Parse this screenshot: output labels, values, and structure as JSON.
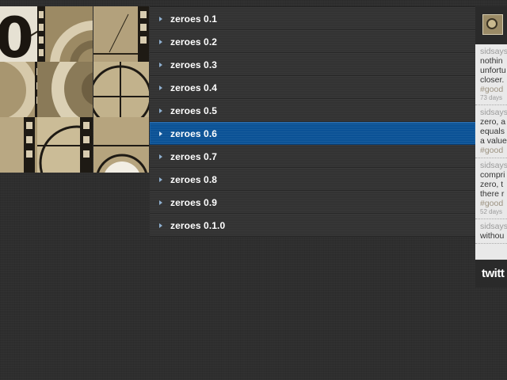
{
  "menu": {
    "items": [
      {
        "label": "zeroes 0.1"
      },
      {
        "label": "zeroes 0.2"
      },
      {
        "label": "zeroes 0.3"
      },
      {
        "label": "zeroes 0.4"
      },
      {
        "label": "zeroes 0.5"
      },
      {
        "label": "zeroes 0.6",
        "active": true
      },
      {
        "label": "zeroes 0.7"
      },
      {
        "label": "zeroes 0.8"
      },
      {
        "label": "zeroes 0.9"
      },
      {
        "label": "zeroes 0.1.0"
      }
    ],
    "active_color": "#0b5296"
  },
  "twitter": {
    "tweets": [
      {
        "user": "sidsays",
        "lines": [
          "nothin",
          "unfortu",
          "closer."
        ],
        "hashtag": "#good",
        "time": "73 days"
      },
      {
        "user": "sidsays",
        "lines": [
          "zero, a",
          "equals",
          "a value"
        ],
        "hashtag": "#good",
        "time": ""
      },
      {
        "user": "sidsays",
        "lines": [
          "compri",
          "zero, t",
          "there r"
        ],
        "hashtag": "#good",
        "time": "52 days"
      },
      {
        "user": "sidsays",
        "lines": [
          "withou"
        ],
        "hashtag": "",
        "time": ""
      }
    ],
    "logo_text": "twitt"
  },
  "mosaic": {
    "countdown_digit": "0",
    "film_tone": "#b3a17c"
  }
}
